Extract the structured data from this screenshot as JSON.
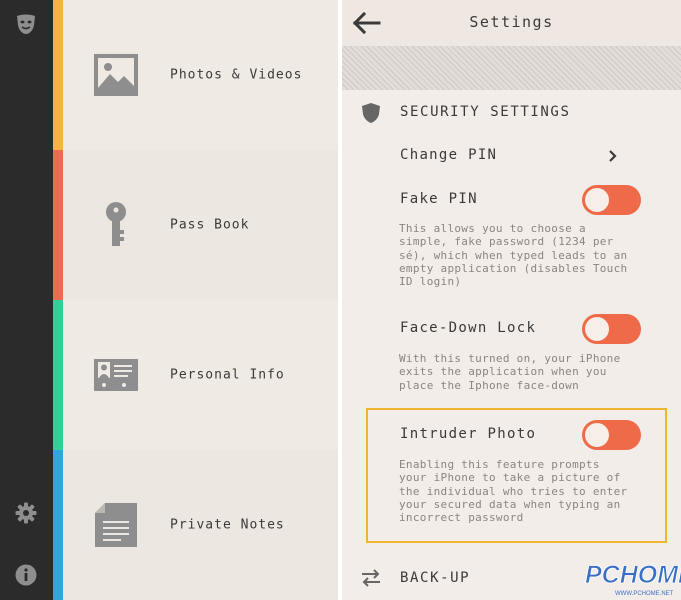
{
  "left_screen": {
    "categories": [
      {
        "label": "Photos & Videos",
        "icon": "photo-icon",
        "color": "#f4b53f"
      },
      {
        "label": "Pass Book",
        "icon": "key-icon",
        "color": "#ef6b4f"
      },
      {
        "label": "Personal Info",
        "icon": "id-card-icon",
        "color": "#2ed297"
      },
      {
        "label": "Private Notes",
        "icon": "notes-icon",
        "color": "#2da7dc"
      }
    ],
    "sidebar_icons": [
      "mask-icon",
      "gear-icon",
      "info-icon"
    ]
  },
  "right_screen": {
    "title": "Settings",
    "section_heading": "SECURITY SETTINGS",
    "change_pin_label": "Change PIN",
    "fake_pin": {
      "label": "Fake PIN",
      "toggle_on": false,
      "description": "This allows you to choose a simple, fake password (1234 per sé), which when typed leads to an empty application (disables Touch ID login)"
    },
    "face_down_lock": {
      "label": "Face-Down Lock",
      "toggle_on": false,
      "description": "With this turned on, your iPhone exits the application when you place the Iphone face-down"
    },
    "intruder_photo": {
      "label": "Intruder Photo",
      "toggle_on": false,
      "description": "Enabling this feature prompts your iPhone to take a picture of the individual who tries to enter your secured data when typing an incorrect password"
    },
    "backup_label": "BACK-UP"
  },
  "watermark": {
    "text": "PCHOME",
    "subtext": "WWW.PCHOME.NET"
  },
  "colors": {
    "toggle": "#ee6a48",
    "highlight": "#f0b431",
    "rail": "#2b2b2b",
    "left_bg": "#efe9e3",
    "right_bg": "#f2ede8"
  }
}
